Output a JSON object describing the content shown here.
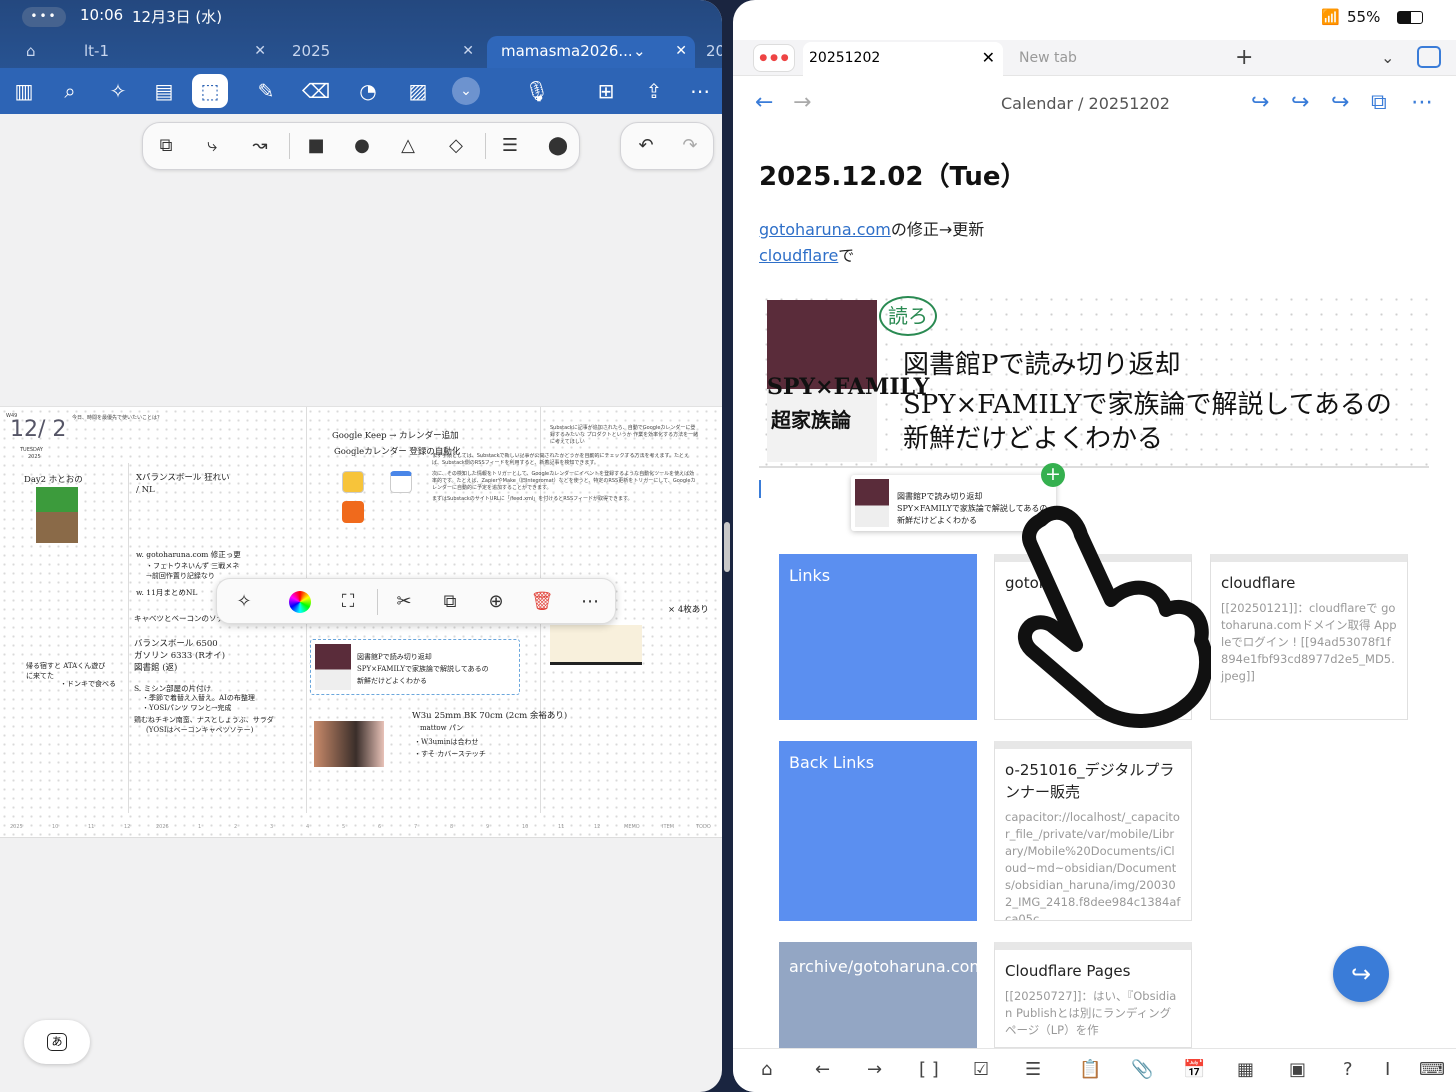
{
  "left": {
    "status": {
      "time": "10:06",
      "date": "12月3日 (水)"
    },
    "tabs": [
      {
        "label": "lt-1"
      },
      {
        "label": "2025"
      },
      {
        "label": "mamasma2026...",
        "active": true
      },
      {
        "label": "20"
      }
    ],
    "toolbar_icons": [
      "sidebar-icon",
      "search-icon",
      "ai-sparkle-icon",
      "notes-icon",
      "lasso-select-icon",
      "pen-icon",
      "eraser-icon",
      "shape-icon",
      "image-icon",
      "more-down-icon",
      "mic-icon",
      "add-page-icon",
      "share-icon",
      "ellipsis-icon"
    ],
    "shape_tools": [
      "shape-recognize-icon",
      "connector-icon",
      "curve-connector-icon",
      "rectangle-icon",
      "circle-icon",
      "triangle-icon",
      "diamond-icon",
      "line-weight-icon",
      "color-icon"
    ],
    "planner": {
      "week": "W49",
      "prompt": "今日、時間を最優先で使いたいことは？",
      "date": "12/ 2",
      "weekday": "TUESDAY",
      "year": "2025",
      "notes": [
        "Day2 ホとおの",
        "Xバランスボール 狂れい",
        "/ NL",
        "w. gotoharuna.com 修正っ更",
        "・フェトウネいんず 三戦メネ",
        "→前回作置り記録なり",
        "w. 11月まとめNL",
        "キャベツとベーコンのソテー",
        "バランスボール 6500",
        "ガソリン 6333 (Rオイ)",
        "図書館 (返)",
        "S. ミシン部屋の片付け",
        "・季節で着替え入替え。AIの布整理",
        "・YOSIパンツ ワンと→完成",
        "鶏むねチキン南蛮、ナスとしょうぶ、サラダ",
        "(YOSIはベーコンキャベツソテー)",
        "帰る宿すと ATAくん遊びに来てた",
        "・ドンキで食べる",
        "Google Keep → カレンダー追加",
        "Googleカレンダー 登録の自動化",
        "W3u 25mm BK 70cm (2cm 余裕あり)",
        "mattow パン",
        "・W3uminは合わせ",
        "・すそ カバーステッチ",
        "× 4枚あり"
      ],
      "inserted_card": [
        "図書館Pで読み切り返却",
        "SPY×FAMILYで家族論で解説してあるの",
        "新鮮だけどよくわかる"
      ],
      "axis": [
        "2025",
        "10",
        "11",
        "12",
        "2026",
        "1",
        "2",
        "3",
        "4",
        "5",
        "6",
        "7",
        "8",
        "9",
        "10",
        "11",
        "12",
        "MEMO",
        "ITEM",
        "TODO"
      ],
      "text_block": [
        "Substackに記事が追加されたら、自動でGoogleカレンダーに登録するみたいな プロダクトというか 作業を効率化する方法を一緒に考えてほしい",
        "まず手順としては、Substackで新しい記事が公開されたかどうかを自動的にチェックする方法を考えます。たとえば、Substack側のRSSフィードを利用すると、新着記事を検知できます。",
        "次に、その検知した情報をトリガーとして、Googleカレンダーにイベントを登録するような自動化ツールを使えば効率的です。たとえば、ZapierやMake（旧Integromat）などを使うと、特定のRSS更新をトリガーにして、Googleカレンダーに自動的に予定を追加することができます。",
        "まずはSubstackのサイトURLに「/feed.xml」を付けるとRSSフィードが取得できます。"
      ]
    },
    "float_tools": [
      "ai-sparkle-icon",
      "color-wheel-icon",
      "resize-icon",
      "scissors-icon",
      "copy-icon",
      "duplicate-icon",
      "trash-icon",
      "ellipsis-icon"
    ],
    "ime_label": "あ"
  },
  "right": {
    "status": {
      "battery": "55%"
    },
    "tabs": [
      {
        "label": "20251202",
        "active": true
      },
      {
        "label": "New tab"
      }
    ],
    "breadcrumb": {
      "parent": "Calendar",
      "sep": "/",
      "current": "20251202"
    },
    "title": "2025.12.02（Tue）",
    "line1": {
      "link": "gotoharuna.com",
      "text": "の修正→更新"
    },
    "line2": {
      "link": "cloudflare",
      "text": "で"
    },
    "image_note": {
      "stamp": "読ろ",
      "cover_title": "SPY×FAMILY",
      "cover_sub": "超家族論",
      "lines": [
        "図書館Pで読み切り返却",
        "SPY×FAMILYで家族論で解説してあるの",
        "新鮮だけどよくわかる"
      ]
    },
    "cards": {
      "links": "Links",
      "back_links": "Back Links",
      "gotoha": "gotoha",
      "cloudflare_title": "cloudflare",
      "cloudflare_body": "[[20250121]]：cloudflareで gotoharuna.comドメイン取得 Appleでログイン ! [[94ad53078f1f894e1fbf93cd8977d2e5_MD5.jpeg]]",
      "o_title": "o-251016_デジタルプランナー販売",
      "o_body": "capacitor://localhost/_capacitor_file_/private/var/mobile/Library/Mobile%20Documents/iCloud~md~obsidian/Documents/obsidian_haruna/img/200302_IMG_2418.f8dee984c1384afca05c",
      "archive": "archive/gotoharuna.com",
      "pages_title": "Cloudflare Pages",
      "pages_body": "[[20250727]]：はい、『Obsidian Publishとは別にランディングページ（LP）を作"
    },
    "bottom_icons": [
      "tag-icon",
      "back-arrow-icon",
      "forward-arrow-icon",
      "bracket-icon",
      "checkbox-icon",
      "list-icon",
      "clipboard-icon",
      "attachment-icon",
      "calendar-icon",
      "calendar-grid-icon",
      "calendar-add-icon",
      "help-icon",
      "cursor-icon",
      "keyboard-icon"
    ]
  }
}
